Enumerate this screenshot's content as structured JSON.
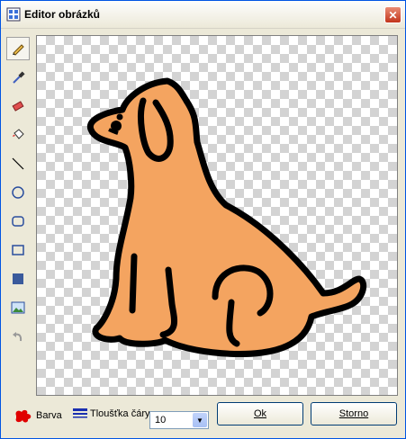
{
  "window": {
    "title": "Editor obrázků"
  },
  "toolbar": {
    "tools": [
      {
        "icon": "pencil-icon",
        "active": true
      },
      {
        "icon": "eyedropper-icon"
      },
      {
        "icon": "eraser-icon"
      },
      {
        "icon": "fill-bucket-icon"
      },
      {
        "icon": "line-icon"
      },
      {
        "icon": "ellipse-icon"
      },
      {
        "icon": "rounded-rectangle-icon"
      },
      {
        "icon": "rectangle-icon"
      },
      {
        "icon": "filled-rectangle-icon"
      },
      {
        "icon": "image-icon"
      },
      {
        "icon": "undo-icon"
      }
    ]
  },
  "canvas": {
    "image": "dog-drawing",
    "fill_color": "#f4a460",
    "outline_color": "#000000"
  },
  "bottom": {
    "color_label": "Barva",
    "line_width_label": "Tloušťka čáry",
    "line_width_value": "10",
    "ok_label": "Ok",
    "cancel_label": "Storno",
    "current_color": "#e00000"
  }
}
